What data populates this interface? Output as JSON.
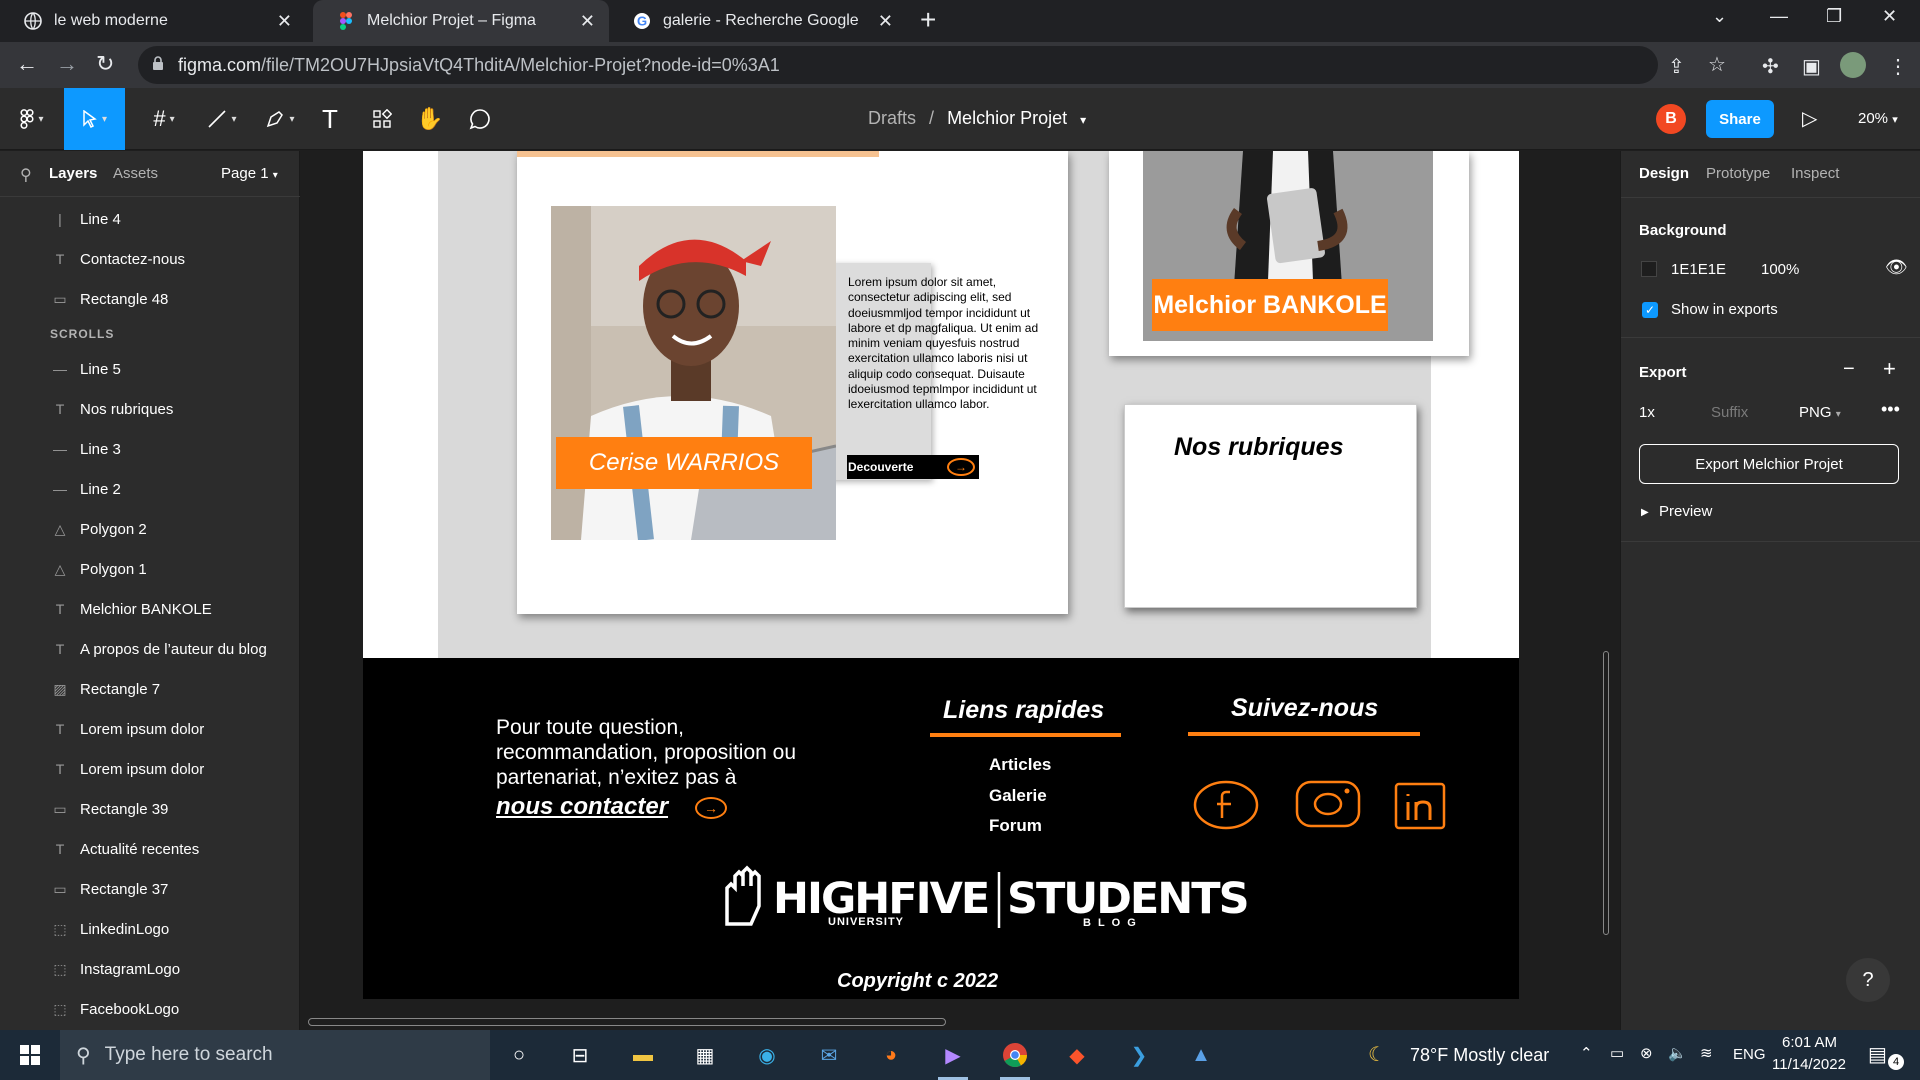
{
  "browser": {
    "tabs": [
      {
        "title": "le web moderne",
        "favicon": "globe-icon",
        "active": false
      },
      {
        "title": "Melchior Projet – Figma",
        "favicon": "figma-icon",
        "active": true
      },
      {
        "title": "galerie - Recherche Google",
        "favicon": "google-icon",
        "active": false
      }
    ],
    "url_host": "figma.com",
    "url_path": "/file/TM2OU7HJpsiaVtQ4ThditA/Melchior-Projet?node-id=0%3A1"
  },
  "figma": {
    "breadcrumb_drafts": "Drafts",
    "breadcrumb_sep": "/",
    "project_name": "Melchior Projet",
    "avatar_initial": "B",
    "share_label": "Share",
    "zoom_label": "20%",
    "tools": [
      "main-menu-icon",
      "move-icon",
      "frame-icon",
      "line-icon",
      "pen-icon",
      "text-icon",
      "resources-icon",
      "hand-icon",
      "comment-icon"
    ],
    "accent_color": "#0d99ff"
  },
  "left_panel": {
    "tab_layers": "Layers",
    "tab_assets": "Assets",
    "page_label": "Page 1",
    "section_label": "SCROLLS",
    "layers_top": [
      {
        "name": "Line 4",
        "icon": "vertical-line-icon"
      },
      {
        "name": "Contactez-nous",
        "icon": "text-icon"
      },
      {
        "name": "Rectangle 48",
        "icon": "rectangle-icon"
      }
    ],
    "layers": [
      {
        "name": "Line 5",
        "icon": "line-icon"
      },
      {
        "name": "Nos rubriques",
        "icon": "text-icon"
      },
      {
        "name": "Line 3",
        "icon": "line-icon"
      },
      {
        "name": "Line 2",
        "icon": "line-icon"
      },
      {
        "name": "Polygon 2",
        "icon": "polygon-icon"
      },
      {
        "name": "Polygon 1",
        "icon": "polygon-icon"
      },
      {
        "name": "Melchior BANKOLE",
        "icon": "text-icon"
      },
      {
        "name": "A propos de l’auteur du blog",
        "icon": "text-icon"
      },
      {
        "name": "Rectangle 7",
        "icon": "image-icon"
      },
      {
        "name": "Lorem ipsum dolor",
        "icon": "text-icon"
      },
      {
        "name": "Lorem ipsum dolor",
        "icon": "text-icon"
      },
      {
        "name": "Rectangle 39",
        "icon": "rectangle-icon"
      },
      {
        "name": "Actualité recentes",
        "icon": "text-icon"
      },
      {
        "name": "Rectangle 37",
        "icon": "rectangle-icon"
      },
      {
        "name": "LinkedinLogo",
        "icon": "dashed-frame-icon"
      },
      {
        "name": "InstagramLogo",
        "icon": "dashed-frame-icon"
      },
      {
        "name": "FacebookLogo",
        "icon": "dashed-frame-icon"
      }
    ]
  },
  "right_panel": {
    "tab_design": "Design",
    "tab_prototype": "Prototype",
    "tab_inspect": "Inspect",
    "background_title": "Background",
    "bg_hex": "1E1E1E",
    "bg_opacity": "100%",
    "show_in_exports": "Show in exports",
    "export_title": "Export",
    "export_scale": "1x",
    "export_suffix_placeholder": "Suffix",
    "export_format": "PNG",
    "export_button": "Export Melchior Projet",
    "preview_label": "Preview",
    "help_label": "?"
  },
  "design": {
    "lorem_text": "Lorem ipsum dolor sit amet, consectetur adipiscing elit, sed doeiusmmljod tempor incididunt ut labore et dp magfaliqua. Ut enim ad minim veniam quyesfuis nostrud exercitation ullamco laboris nisi ut aliquip codo consequat. Duisaute idoeiusmod tepmlmpor incididunt ut lexercitation ullamco labor.",
    "decouverte": "Decouverte",
    "name1": "Cerise WARRIOS",
    "name2": "Melchior BANKOLE",
    "nos_rubriques": "Nos rubriques",
    "contact_text": "Pour toute question, recommandation, proposition ou partenariat, n’exitez pas à",
    "contact_link": "nous contacter",
    "quick_links_title": "Liens rapides",
    "follow_title": "Suivez-nous",
    "quick_links": [
      "Articles",
      "Galerie",
      "Forum"
    ],
    "logo_left": "HIGHFIVE",
    "logo_left_sub": "UNIVERSITY",
    "logo_right": "STUDENTS",
    "logo_right_sub": "BLOG",
    "copyright": "Copyright c 2022",
    "orange": "#ff7f11"
  },
  "taskbar": {
    "search_placeholder": "Type here to search",
    "weather": "78°F  Mostly clear",
    "lang": "ENG",
    "time": "6:01 AM",
    "date": "11/14/2022",
    "notif_count": "4",
    "apps": [
      "task-view-icon",
      "widgets-icon",
      "file-explorer-icon",
      "store-icon",
      "edge-icon",
      "mail-icon",
      "firefox-icon",
      "visual-studio-icon",
      "chrome-icon",
      "brave-icon",
      "vscode-icon",
      "photos-icon"
    ]
  }
}
